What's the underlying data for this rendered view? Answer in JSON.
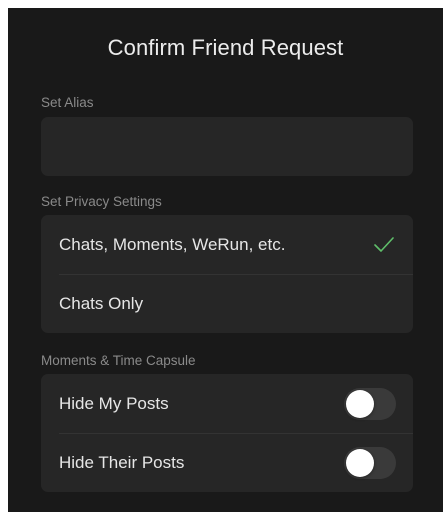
{
  "header": {
    "title": "Confirm Friend Request"
  },
  "alias": {
    "label": "Set Alias",
    "value": "",
    "placeholder": ""
  },
  "privacy": {
    "label": "Set Privacy Settings",
    "options": [
      {
        "label": "Chats, Moments, WeRun, etc.",
        "selected": true
      },
      {
        "label": "Chats Only",
        "selected": false
      }
    ],
    "check_color": "#5fbe6a"
  },
  "moments": {
    "label": "Moments & Time Capsule",
    "toggles": [
      {
        "label": "Hide My Posts",
        "on": false
      },
      {
        "label": "Hide Their Posts",
        "on": false
      }
    ]
  },
  "colors": {
    "background": "#191919",
    "card": "#262626",
    "toggle_off": "#3a3a3a"
  }
}
